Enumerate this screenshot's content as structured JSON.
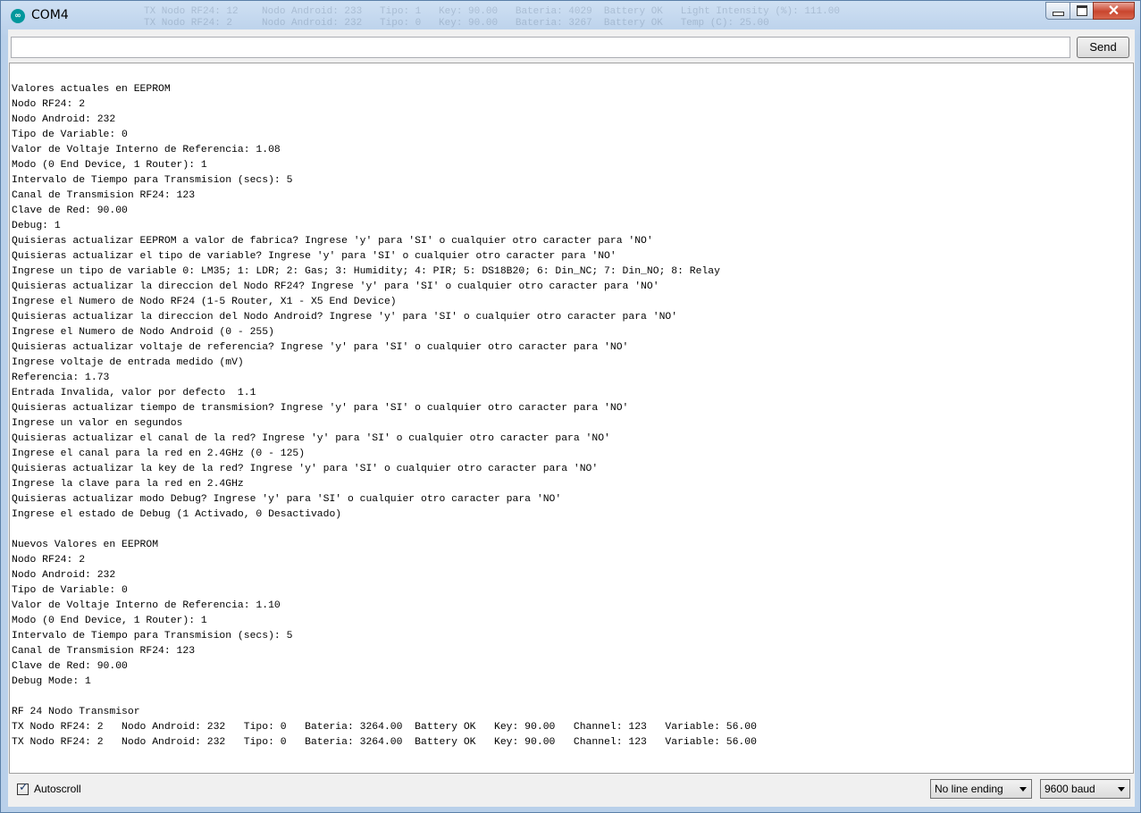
{
  "window": {
    "title": "COM4",
    "icon": "arduino-icon",
    "background_text": [
      "TX Nodo RF24: 12    Nodo Android: 233   Tipo: 1   Key: 90.00   Bateria: 4029  Battery OK   Light Intensity (%): 111.00",
      "TX Nodo RF24: 2     Nodo Android: 232   Tipo: 0   Key: 90.00   Bateria: 3267  Battery OK   Temp (C): 25.00"
    ]
  },
  "input": {
    "value": "",
    "send_label": "Send"
  },
  "output": {
    "lines": [
      "",
      "Valores actuales en EEPROM",
      "Nodo RF24: 2",
      "Nodo Android: 232",
      "Tipo de Variable: 0",
      "Valor de Voltaje Interno de Referencia: 1.08",
      "Modo (0 End Device, 1 Router): 1",
      "Intervalo de Tiempo para Transmision (secs): 5",
      "Canal de Transmision RF24: 123",
      "Clave de Red: 90.00",
      "Debug: 1",
      "Quisieras actualizar EEPROM a valor de fabrica? Ingrese 'y' para 'SI' o cualquier otro caracter para 'NO'",
      "Quisieras actualizar el tipo de variable? Ingrese 'y' para 'SI' o cualquier otro caracter para 'NO'",
      "Ingrese un tipo de variable 0: LM35; 1: LDR; 2: Gas; 3: Humidity; 4: PIR; 5: DS18B20; 6: Din_NC; 7: Din_NO; 8: Relay",
      "Quisieras actualizar la direccion del Nodo RF24? Ingrese 'y' para 'SI' o cualquier otro caracter para 'NO'",
      "Ingrese el Numero de Nodo RF24 (1-5 Router, X1 - X5 End Device)",
      "Quisieras actualizar la direccion del Nodo Android? Ingrese 'y' para 'SI' o cualquier otro caracter para 'NO'",
      "Ingrese el Numero de Nodo Android (0 - 255)",
      "Quisieras actualizar voltaje de referencia? Ingrese 'y' para 'SI' o cualquier otro caracter para 'NO'",
      "Ingrese voltaje de entrada medido (mV)",
      "Referencia: 1.73",
      "Entrada Invalida, valor por defecto  1.1",
      "Quisieras actualizar tiempo de transmision? Ingrese 'y' para 'SI' o cualquier otro caracter para 'NO'",
      "Ingrese un valor en segundos",
      "Quisieras actualizar el canal de la red? Ingrese 'y' para 'SI' o cualquier otro caracter para 'NO'",
      "Ingrese el canal para la red en 2.4GHz (0 - 125)",
      "Quisieras actualizar la key de la red? Ingrese 'y' para 'SI' o cualquier otro caracter para 'NO'",
      "Ingrese la clave para la red en 2.4GHz",
      "Quisieras actualizar modo Debug? Ingrese 'y' para 'SI' o cualquier otro caracter para 'NO'",
      "Ingrese el estado de Debug (1 Activado, 0 Desactivado)",
      "",
      "Nuevos Valores en EEPROM",
      "Nodo RF24: 2",
      "Nodo Android: 232",
      "Tipo de Variable: 0",
      "Valor de Voltaje Interno de Referencia: 1.10",
      "Modo (0 End Device, 1 Router): 1",
      "Intervalo de Tiempo para Transmision (secs): 5",
      "Canal de Transmision RF24: 123",
      "Clave de Red: 90.00",
      "Debug Mode: 1",
      "",
      "RF 24 Nodo Transmisor",
      "TX Nodo RF24: 2   Nodo Android: 232   Tipo: 0   Bateria: 3264.00  Battery OK   Key: 90.00   Channel: 123   Variable: 56.00",
      "TX Nodo RF24: 2   Nodo Android: 232   Tipo: 0   Bateria: 3264.00  Battery OK   Key: 90.00   Channel: 123   Variable: 56.00"
    ]
  },
  "status": {
    "autoscroll_label": "Autoscroll",
    "autoscroll_checked": true,
    "line_ending": "No line ending",
    "baud": "9600 baud"
  }
}
